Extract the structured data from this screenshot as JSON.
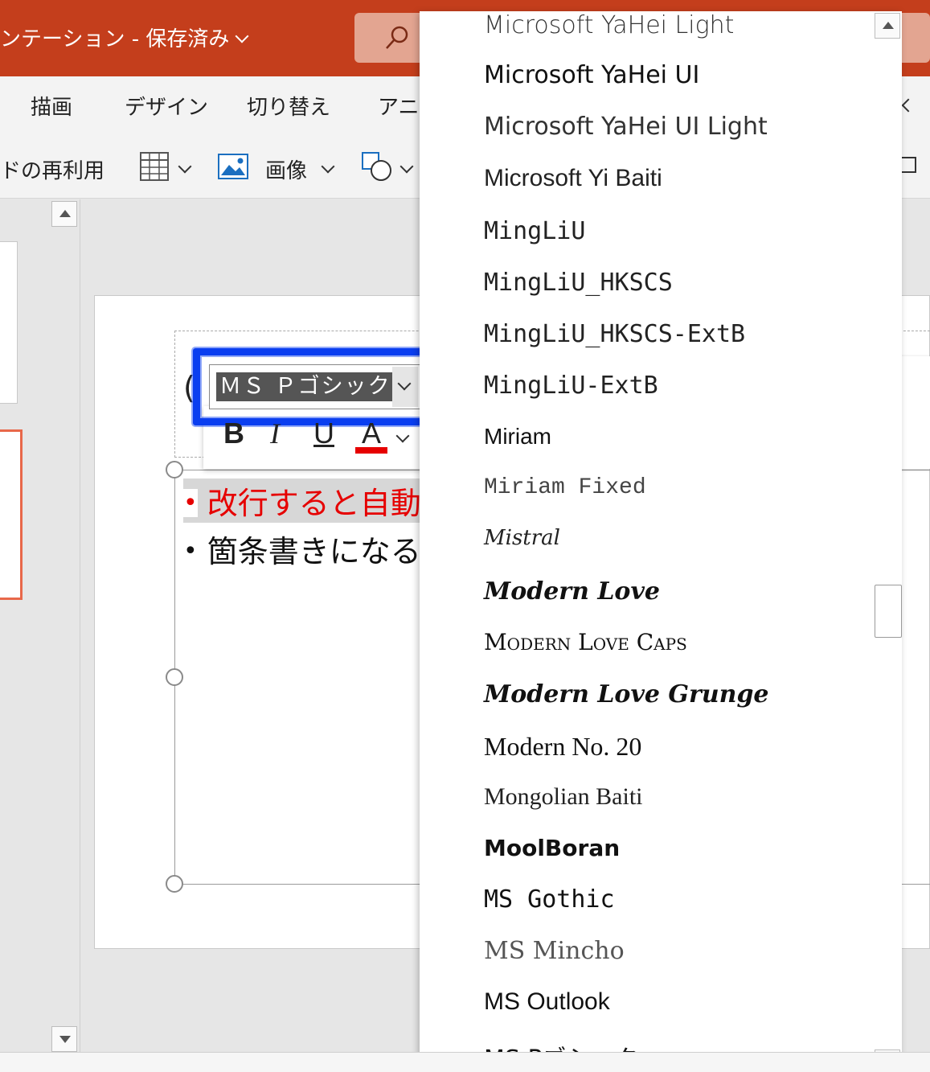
{
  "titlebar": {
    "title": "ンテーション - 保存済み"
  },
  "ribbon": {
    "tabs": [
      "描画",
      "デザイン",
      "切り替え",
      "アニメ"
    ],
    "tools": {
      "reuse_label": "ドの再利用",
      "image_label": "画像"
    }
  },
  "slide": {
    "title_partial": "(",
    "bullets": [
      {
        "text": "改行すると自動",
        "color": "#e60000"
      },
      {
        "text": "箇条書きになる",
        "color": "#111111"
      }
    ]
  },
  "mini_toolbar": {
    "font_value": "ＭＳ Ｐゴシック",
    "bold": "B",
    "italic": "I",
    "underline": "U",
    "font_color": "A",
    "font_color_hex": "#e60000",
    "highlight_color": "#0a3ef0"
  },
  "font_list": {
    "items": [
      "Microsoft YaHei Light",
      "Microsoft YaHei UI",
      "Microsoft YaHei UI Light",
      "Microsoft  Yi  Baiti",
      "MingLiU",
      "MingLiU_HKSCS",
      "MingLiU_HKSCS-ExtB",
      "MingLiU-ExtB",
      "Miriam",
      "Miriam Fixed",
      "Mistral",
      "Modern Love",
      "Modern Love Caps",
      "Modern Love Grunge",
      "Modern No. 20",
      "Mongolian Baiti",
      "MoolBoran",
      "MS  Gothic",
      "MS  Mincho",
      "MS Outlook",
      "MS Pゴシック"
    ]
  }
}
